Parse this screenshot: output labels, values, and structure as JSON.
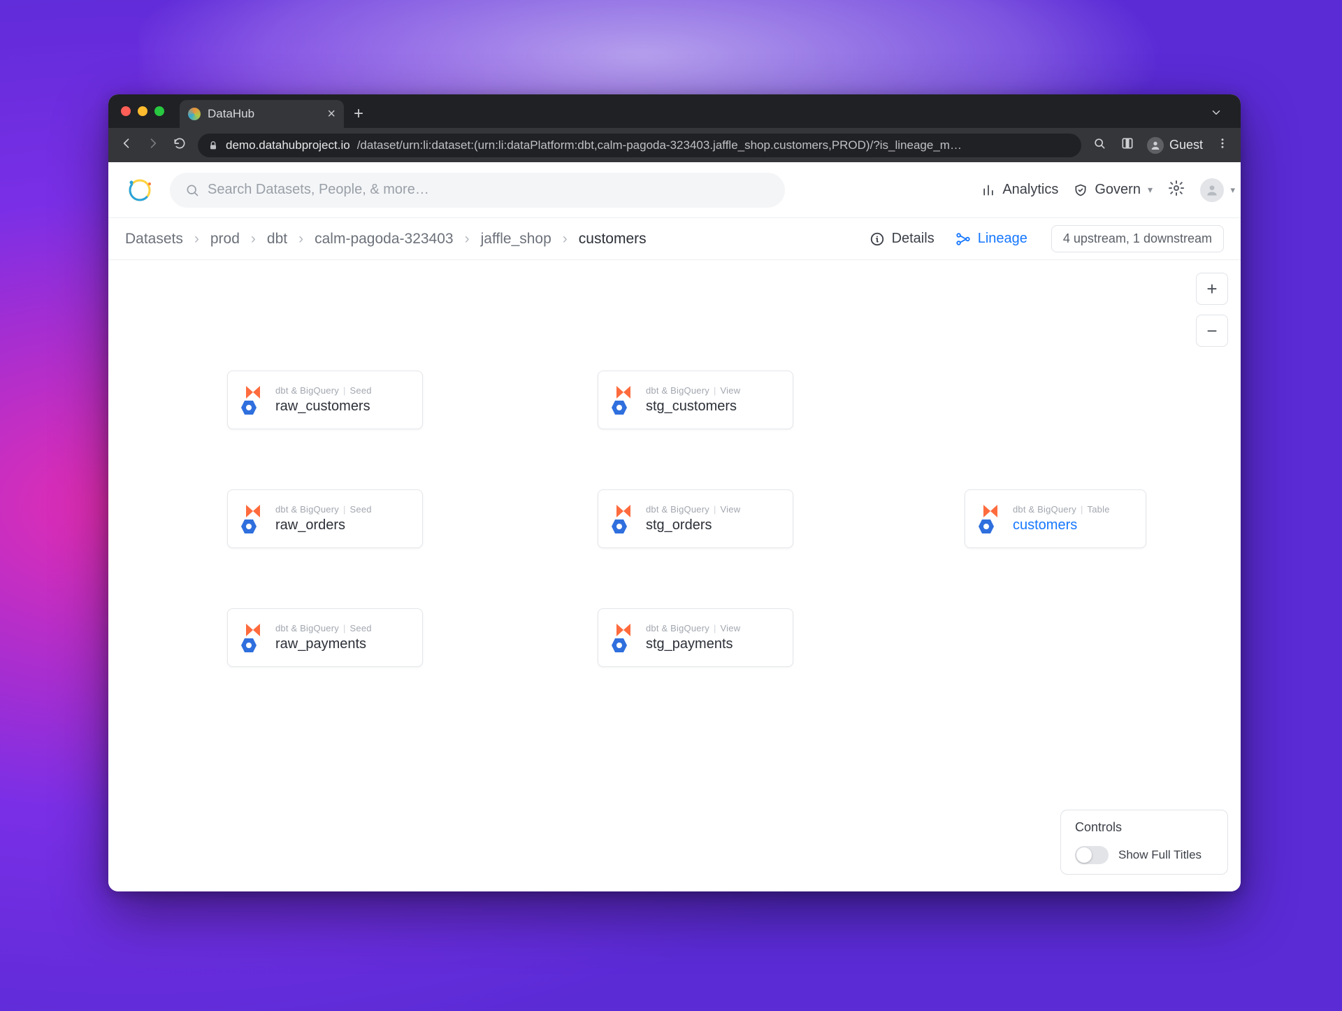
{
  "browser": {
    "tab_title": "DataHub",
    "url_host": "demo.datahubproject.io",
    "url_path": "/dataset/urn:li:dataset:(urn:li:dataPlatform:dbt,calm-pagoda-323403.jaffle_shop.customers,PROD)/?is_lineage_m…",
    "guest_label": "Guest"
  },
  "header": {
    "search_placeholder": "Search Datasets, People, & more…",
    "analytics_label": "Analytics",
    "govern_label": "Govern"
  },
  "breadcrumb": {
    "items": [
      "Datasets",
      "prod",
      "dbt",
      "calm-pagoda-323403",
      "jaffle_shop",
      "customers"
    ]
  },
  "toolbar": {
    "details_label": "Details",
    "lineage_label": "Lineage",
    "summary_pill": "4 upstream, 1 downstream"
  },
  "controls_panel": {
    "title": "Controls",
    "toggle_label": "Show Full Titles"
  },
  "node_meta": {
    "platforms": "dbt & BigQuery",
    "type_seed": "Seed",
    "type_view": "View",
    "type_table": "Table"
  },
  "nodes": {
    "raw_customers": {
      "title": "raw_customers",
      "type_key": "type_seed"
    },
    "raw_orders": {
      "title": "raw_orders",
      "type_key": "type_seed"
    },
    "raw_payments": {
      "title": "raw_payments",
      "type_key": "type_seed"
    },
    "stg_customers": {
      "title": "stg_customers",
      "type_key": "type_view"
    },
    "stg_orders": {
      "title": "stg_orders",
      "type_key": "type_view"
    },
    "stg_payments": {
      "title": "stg_payments",
      "type_key": "type_view"
    },
    "customers": {
      "title": "customers",
      "type_key": "type_table"
    }
  }
}
